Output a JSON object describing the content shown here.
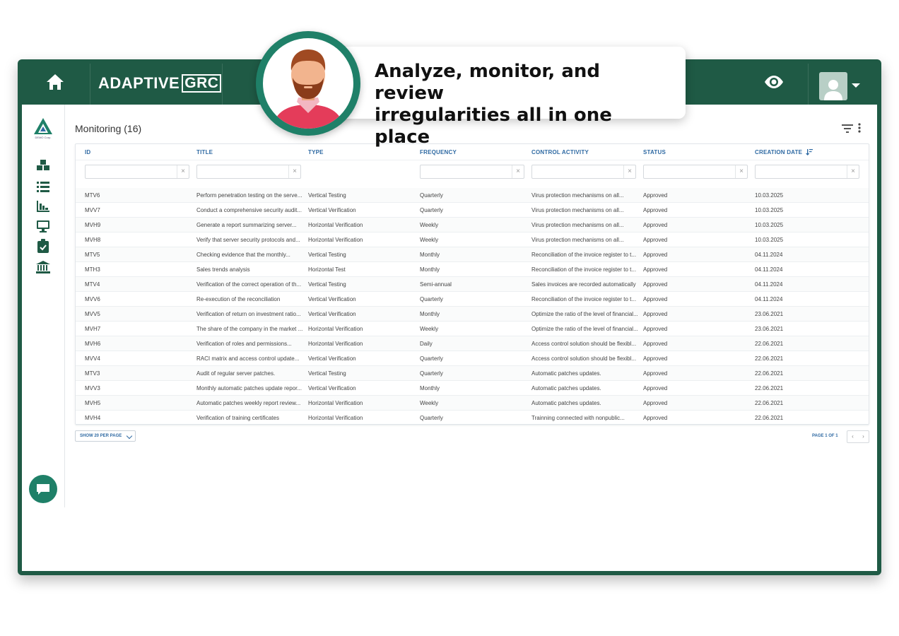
{
  "app": {
    "brand_prefix": "ADAPTIVE",
    "brand_suffix": "GRC",
    "org_caption": "DEMO Corp."
  },
  "callout": {
    "text_line1": "Analyze, monitor, and review",
    "text_line2": "irregularities all in one place"
  },
  "page": {
    "title": "Monitoring (16)"
  },
  "table": {
    "columns": [
      "ID",
      "TITLE",
      "TYPE",
      "FREQUENCY",
      "CONTROL ACTIVITY",
      "STATUS",
      "CREATION DATE"
    ],
    "rows": [
      [
        "MTV6",
        "Perform penetration testing on the serve...",
        "Vertical Testing",
        "Quarterly",
        "Virus protection mechanisms on all...",
        "Approved",
        "10.03.2025"
      ],
      [
        "MVV7",
        "Conduct a comprehensive security audit...",
        "Vertical Verification",
        "Quarterly",
        "Virus protection mechanisms on all...",
        "Approved",
        "10.03.2025"
      ],
      [
        "MVH9",
        "Generate a report summarizing server...",
        "Horizontal Verification",
        "Weekly",
        "Virus protection mechanisms on all...",
        "Approved",
        "10.03.2025"
      ],
      [
        "MVH8",
        "Verify that server security protocols and...",
        "Horizontal Verification",
        "Weekly",
        "Virus protection mechanisms on all...",
        "Approved",
        "10.03.2025"
      ],
      [
        "MTV5",
        "Checking evidence that the monthly...",
        "Vertical Testing",
        "Monthly",
        "Reconciliation of the invoice register to t...",
        "Approved",
        "04.11.2024"
      ],
      [
        "MTH3",
        "Sales trends analysis",
        "Horizontal Test",
        "Monthly",
        "Reconciliation of the invoice register to t...",
        "Approved",
        "04.11.2024"
      ],
      [
        "MTV4",
        "Verification of the correct operation of th...",
        "Vertical Testing",
        "Semi-annual",
        "Sales invoices are recorded automatically",
        "Approved",
        "04.11.2024"
      ],
      [
        "MVV6",
        "Re-execution of the reconciliation",
        "Vertical Verification",
        "Quarterly",
        "Reconciliation of the invoice register to t...",
        "Approved",
        "04.11.2024"
      ],
      [
        "MVV5",
        "Verification of return on investment ratio...",
        "Vertical Verification",
        "Monthly",
        "Optimize the ratio of the level of financial...",
        "Approved",
        "23.06.2021"
      ],
      [
        "MVH7",
        "The share of the company in the market ...",
        "Horizontal Verification",
        "Weekly",
        "Optimize the ratio of the level of financial...",
        "Approved",
        "23.06.2021"
      ],
      [
        "MVH6",
        "Verification of roles and permissions...",
        "Horizontal Verification",
        "Daily",
        "Access control solution should be flexibl...",
        "Approved",
        "22.06.2021"
      ],
      [
        "MVV4",
        "RACI matrix and access control update...",
        "Vertical Verification",
        "Quarterly",
        "Access control solution should be flexibl...",
        "Approved",
        "22.06.2021"
      ],
      [
        "MTV3",
        "Audit of regular server patches.",
        "Vertical Testing",
        "Quarterly",
        "Automatic patches updates.",
        "Approved",
        "22.06.2021"
      ],
      [
        "MVV3",
        "Monthly automatic patches update repor...",
        "Vertical Verification",
        "Monthly",
        "Automatic patches updates.",
        "Approved",
        "22.06.2021"
      ],
      [
        "MVH5",
        "Automatic patches weekly report review...",
        "Horizontal Verification",
        "Weekly",
        "Automatic patches updates.",
        "Approved",
        "22.06.2021"
      ],
      [
        "MVH4",
        "Verification of training certificates",
        "Horizontal Verification",
        "Quarterly",
        "Trainning connected with nonpublic...",
        "Approved",
        "22.06.2021"
      ]
    ]
  },
  "footer": {
    "per_page_label": "SHOW 20 PER PAGE",
    "page_info": "PAGE 1 OF 1",
    "prev": "‹",
    "next": "›"
  },
  "colors": {
    "frame": "#1f5a45",
    "accent": "#1f8068",
    "header_text": "#2f6aa3"
  },
  "icons": {
    "home": "home-icon",
    "eye": "eye-icon",
    "user": "user-icon",
    "sidebar": [
      "cubes-icon",
      "list-icon",
      "bar-chart-icon",
      "monitor-icon",
      "clipboard-check-icon",
      "bank-icon"
    ],
    "chat": "chat-icon"
  }
}
